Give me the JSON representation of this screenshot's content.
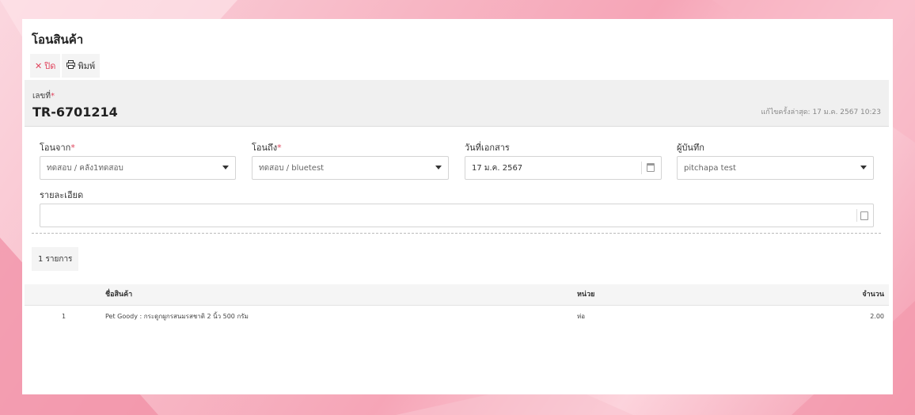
{
  "page": {
    "title": "โอนสินค้า"
  },
  "toolbar": {
    "close_label": "ปิด",
    "close_icon": "close-icon",
    "print_label": "พิมพ์",
    "print_icon": "printer-icon"
  },
  "document": {
    "number_label": "เลขที่",
    "required_mark": "*",
    "number_value": "TR-6701214",
    "last_updated": "แก้ไขครั้งล่าสุด: 17 ม.ค. 2567 10:23"
  },
  "form": {
    "from": {
      "label": "โอนจาก",
      "value": "ทดสอบ / คลัง1ทดสอบ"
    },
    "to": {
      "label": "โอนถึง",
      "value": "ทดสอบ / bluetest"
    },
    "date": {
      "label": "วันที่เอกสาร",
      "value": "17 ม.ค. 2567"
    },
    "recorder": {
      "label": "ผู้บันทึก",
      "value": "pitchapa test"
    },
    "details": {
      "label": "รายละเอียด",
      "value": ""
    }
  },
  "items_count": "1 รายการ",
  "table": {
    "columns": [
      "",
      "ชื่อสินค้า",
      "หน่วย",
      "จำนวน"
    ],
    "rows": [
      [
        "1",
        "Pet Goody : กระดูกผูกรสนมรสชาติ 2 นิ้ว 500 กรัม",
        "ห่อ",
        "2.00"
      ]
    ]
  },
  "colors": {
    "accent_red": "#e0445d",
    "background_pink": "#f6a5b7"
  }
}
